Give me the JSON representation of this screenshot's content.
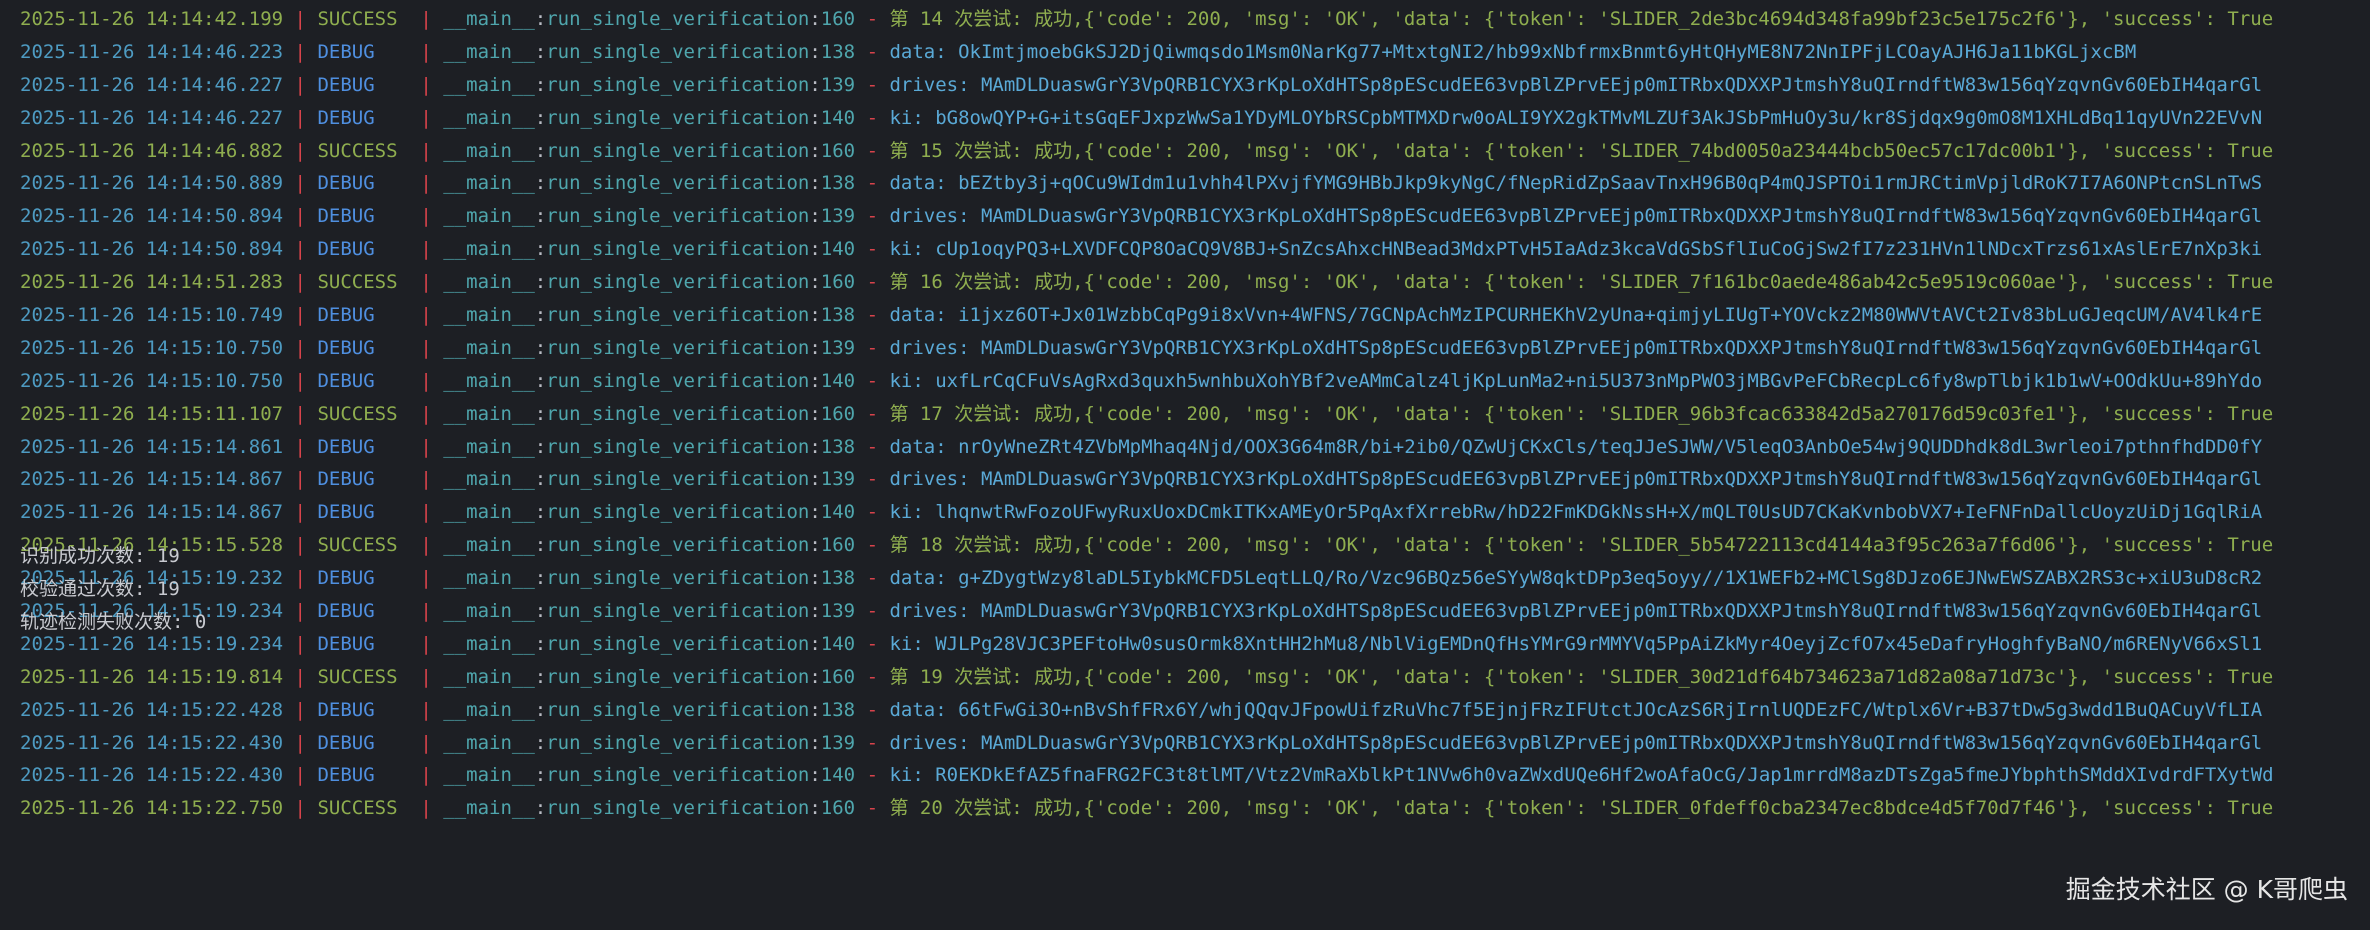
{
  "log": {
    "lines": [
      {
        "ts": "2025-11-26 14:14:42.199",
        "level": "SUCCESS",
        "module": "__main__",
        "func": "run_single_verification",
        "line": "160",
        "msg": "第 14 次尝试: 成功,{'code': 200, 'msg': 'OK', 'data': {'token': 'SLIDER_2de3bc4694d348fa99bf23c5e175c2f6'}, 'success': True"
      },
      {
        "ts": "2025-11-26 14:14:46.223",
        "level": "DEBUG",
        "module": "__main__",
        "func": "run_single_verification",
        "line": "138",
        "msg": "data: OkImtjmoebGkSJ2DjQiwmqsdo1Msm0NarKg77+MtxtgNI2/hb99xNbfrmxBnmt6yHtQHyME8N72NnIPFjLCOayAJH6Ja11bKGLjxcBM"
      },
      {
        "ts": "2025-11-26 14:14:46.227",
        "level": "DEBUG",
        "module": "__main__",
        "func": "run_single_verification",
        "line": "139",
        "msg": "drives: MAmDLDuaswGrY3VpQRB1CYX3rKpLoXdHTSp8pEScudEE63vpBlZPrvEEjp0mITRbxQDXXPJtmshY8uQIrndftW83w156qYzqvnGv60EbIH4qarGl"
      },
      {
        "ts": "2025-11-26 14:14:46.227",
        "level": "DEBUG",
        "module": "__main__",
        "func": "run_single_verification",
        "line": "140",
        "msg": "ki: bG8owQYP+G+itsGqEFJxpzWwSa1YDyMLOYbRSCpbMTMXDrw0oALI9YX2gkTMvMLZUf3AkJSbPmHuOy3u/kr8Sjdqx9g0mO8M1XHLdBq11qyUVn22EVvN"
      },
      {
        "ts": "2025-11-26 14:14:46.882",
        "level": "SUCCESS",
        "module": "__main__",
        "func": "run_single_verification",
        "line": "160",
        "msg": "第 15 次尝试: 成功,{'code': 200, 'msg': 'OK', 'data': {'token': 'SLIDER_74bd0050a23444bcb50ec57c17dc00b1'}, 'success': True"
      },
      {
        "ts": "2025-11-26 14:14:50.889",
        "level": "DEBUG",
        "module": "__main__",
        "func": "run_single_verification",
        "line": "138",
        "msg": "data: bEZtby3j+qOCu9WIdm1u1vhh4lPXvjfYMG9HBbJkp9kyNgC/fNepRidZpSaavTnxH96B0qP4mQJSPTOi1rmJRCtimVpjldRoK7I7A6ONPtcnSLnTwS"
      },
      {
        "ts": "2025-11-26 14:14:50.894",
        "level": "DEBUG",
        "module": "__main__",
        "func": "run_single_verification",
        "line": "139",
        "msg": "drives: MAmDLDuaswGrY3VpQRB1CYX3rKpLoXdHTSp8pEScudEE63vpBlZPrvEEjp0mITRbxQDXXPJtmshY8uQIrndftW83w156qYzqvnGv60EbIH4qarGl"
      },
      {
        "ts": "2025-11-26 14:14:50.894",
        "level": "DEBUG",
        "module": "__main__",
        "func": "run_single_verification",
        "line": "140",
        "msg": "ki: cUp1oqyPQ3+LXVDFCQP8OaCQ9V8BJ+SnZcsAhxcHNBead3MdxPTvH5IaAdz3kcaVdGSbSflIuCoGjSw2fI7z231HVn1lNDcxTrzs61xAslErE7nXp3ki"
      },
      {
        "ts": "2025-11-26 14:14:51.283",
        "level": "SUCCESS",
        "module": "__main__",
        "func": "run_single_verification",
        "line": "160",
        "msg": "第 16 次尝试: 成功,{'code': 200, 'msg': 'OK', 'data': {'token': 'SLIDER_7f161bc0aede486ab42c5e9519c060ae'}, 'success': True"
      },
      {
        "ts": "2025-11-26 14:15:10.749",
        "level": "DEBUG",
        "module": "__main__",
        "func": "run_single_verification",
        "line": "138",
        "msg": "data: i1jxz6OT+Jx01WzbbCqPg9i8xVvn+4WFNS/7GCNpAchMzIPCURHEKhV2yUna+qimjyLIUgT+YOVckz2M80WWVtAVCt2Iv83bLuGJeqcUM/AV4lk4rE"
      },
      {
        "ts": "2025-11-26 14:15:10.750",
        "level": "DEBUG",
        "module": "__main__",
        "func": "run_single_verification",
        "line": "139",
        "msg": "drives: MAmDLDuaswGrY3VpQRB1CYX3rKpLoXdHTSp8pEScudEE63vpBlZPrvEEjp0mITRbxQDXXPJtmshY8uQIrndftW83w156qYzqvnGv60EbIH4qarGl"
      },
      {
        "ts": "2025-11-26 14:15:10.750",
        "level": "DEBUG",
        "module": "__main__",
        "func": "run_single_verification",
        "line": "140",
        "msg": "ki: uxfLrCqCFuVsAgRxd3quxh5wnhbuXohYBf2veAMmCalz4ljKpLunMa2+ni5U373nMpPWO3jMBGvPeFCbRecpLc6fy8wpTlbjk1b1wV+OOdkUu+89hYdo"
      },
      {
        "ts": "2025-11-26 14:15:11.107",
        "level": "SUCCESS",
        "module": "__main__",
        "func": "run_single_verification",
        "line": "160",
        "msg": "第 17 次尝试: 成功,{'code': 200, 'msg': 'OK', 'data': {'token': 'SLIDER_96b3fcac633842d5a270176d59c03fe1'}, 'success': True"
      },
      {
        "ts": "2025-11-26 14:15:14.861",
        "level": "DEBUG",
        "module": "__main__",
        "func": "run_single_verification",
        "line": "138",
        "msg": "data: nrOyWneZRt4ZVbMpMhaq4Njd/OOX3G64m8R/bi+2ib0/QZwUjCKxCls/teqJJeSJWW/V5leqO3AnbOe54wj9QUDDhdk8dL3wrleoi7pthnfhdDD0fY"
      },
      {
        "ts": "2025-11-26 14:15:14.867",
        "level": "DEBUG",
        "module": "__main__",
        "func": "run_single_verification",
        "line": "139",
        "msg": "drives: MAmDLDuaswGrY3VpQRB1CYX3rKpLoXdHTSp8pEScudEE63vpBlZPrvEEjp0mITRbxQDXXPJtmshY8uQIrndftW83w156qYzqvnGv60EbIH4qarGl"
      },
      {
        "ts": "2025-11-26 14:15:14.867",
        "level": "DEBUG",
        "module": "__main__",
        "func": "run_single_verification",
        "line": "140",
        "msg": "ki: lhqnwtRwFozoUFwyRuxUoxDCmkITKxAMEyOr5PqAxfXrrebRw/hD22FmKDGkNssH+X/mQLT0UsUD7CKaKvnbobVX7+IeFNFnDallcUoyzUiDj1GqlRiA"
      },
      {
        "ts": "2025-11-26 14:15:15.528",
        "level": "SUCCESS",
        "module": "__main__",
        "func": "run_single_verification",
        "line": "160",
        "msg": "第 18 次尝试: 成功,{'code': 200, 'msg': 'OK', 'data': {'token': 'SLIDER_5b54722113cd4144a3f95c263a7f6d06'}, 'success': True"
      },
      {
        "ts": "2025-11-26 14:15:19.232",
        "level": "DEBUG",
        "module": "__main__",
        "func": "run_single_verification",
        "line": "138",
        "msg": "data: g+ZDygtWzy8laDL5IybkMCFD5LeqtLLQ/Ro/Vzc96BQz56eSYyW8qktDPp3eq5oyy//1X1WEFb2+MClSg8DJzo6EJNwEWSZABX2RS3c+xiU3uD8cR2"
      },
      {
        "ts": "2025-11-26 14:15:19.234",
        "level": "DEBUG",
        "module": "__main__",
        "func": "run_single_verification",
        "line": "139",
        "msg": "drives: MAmDLDuaswGrY3VpQRB1CYX3rKpLoXdHTSp8pEScudEE63vpBlZPrvEEjp0mITRbxQDXXPJtmshY8uQIrndftW83w156qYzqvnGv60EbIH4qarGl"
      },
      {
        "ts": "2025-11-26 14:15:19.234",
        "level": "DEBUG",
        "module": "__main__",
        "func": "run_single_verification",
        "line": "140",
        "msg": "ki: WJLPg28VJC3PEFtoHw0susOrmk8XntHH2hMu8/NblVigEMDnQfHsYMrG9rMMYVq5PpAiZkMyr4OeyjZcfO7x45eDafryHoghfyBaNO/m6RENyV66xSl1"
      },
      {
        "ts": "2025-11-26 14:15:19.814",
        "level": "SUCCESS",
        "module": "__main__",
        "func": "run_single_verification",
        "line": "160",
        "msg": "第 19 次尝试: 成功,{'code': 200, 'msg': 'OK', 'data': {'token': 'SLIDER_30d21df64b734623a71d82a08a71d73c'}, 'success': True"
      },
      {
        "ts": "2025-11-26 14:15:22.428",
        "level": "DEBUG",
        "module": "__main__",
        "func": "run_single_verification",
        "line": "138",
        "msg": "data: 66tFwGi3O+nBvShfFRx6Y/whjQQqvJFpowUifzRuVhc7f5EjnjFRzIFUtctJOcAzS6RjIrnlUQDEzFC/Wtplx6Vr+B37tDw5g3wdd1BuQACuyVfLIA"
      },
      {
        "ts": "2025-11-26 14:15:22.430",
        "level": "DEBUG",
        "module": "__main__",
        "func": "run_single_verification",
        "line": "139",
        "msg": "drives: MAmDLDuaswGrY3VpQRB1CYX3rKpLoXdHTSp8pEScudEE63vpBlZPrvEEjp0mITRbxQDXXPJtmshY8uQIrndftW83w156qYzqvnGv60EbIH4qarGl"
      },
      {
        "ts": "2025-11-26 14:15:22.430",
        "level": "DEBUG",
        "module": "__main__",
        "func": "run_single_verification",
        "line": "140",
        "msg": "ki: R0EKDkEfAZ5fnaFRG2FC3t8tlMT/Vtz2VmRaXblkPt1NVw6h0vaZWxdUQe6Hf2woAfaOcG/Jap1mrrdM8azDTsZga5fmeJYbphthSMddXIvdrdFTXytWd"
      },
      {
        "ts": "2025-11-26 14:15:22.750",
        "level": "SUCCESS",
        "module": "__main__",
        "func": "run_single_verification",
        "line": "160",
        "msg": "第 20 次尝试: 成功,{'code': 200, 'msg': 'OK', 'data': {'token': 'SLIDER_0fdeff0cba2347ec8bdce4d5f70d7f46'}, 'success': True"
      }
    ]
  },
  "summary": {
    "recognized": "识别成功次数: 19",
    "verified": "校验通过次数: 19",
    "track_failed": "轨迹检测失败次数: 0"
  },
  "watermark": "掘金技术社区 @ K哥爬虫",
  "colors": {
    "background": "#1d1f24",
    "success": "#8fae4f",
    "debug_level": "#4f8fe0",
    "debug_text": "#5aa9d6",
    "separator": "#d8434b",
    "module": "#4fa6ad"
  }
}
